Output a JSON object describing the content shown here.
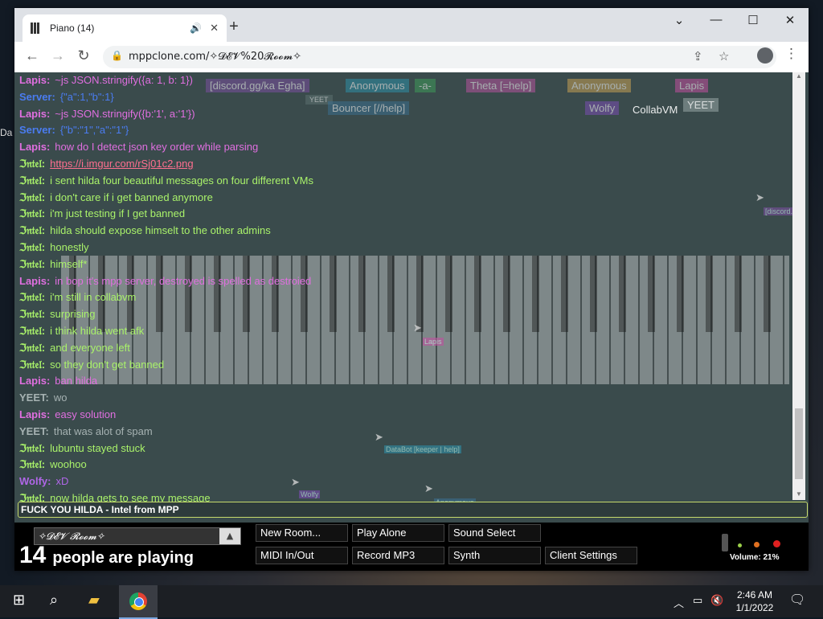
{
  "desktop": {
    "edge_labels": [
      "Da"
    ]
  },
  "browser": {
    "tab_title": "Piano (14)",
    "tab_close": "✕",
    "new_tab": "+",
    "url": "mppclone.com/✧𝓓𝓔𝓥%20𝓡𝓸𝓸𝓶✧",
    "window_controls": {
      "dropdown": "⌄",
      "minimize": "—",
      "maximize": "☐",
      "close": "✕"
    }
  },
  "page": {
    "ghost_tags": [
      {
        "text": "[discord.gg/ka Egha]",
        "bg": "#7a4f9e"
      },
      {
        "text": "Anonymous",
        "bg": "#2f8fa6"
      },
      {
        "text": "-a-",
        "bg": "#3f9a5a"
      },
      {
        "text": "Theta [=help]",
        "bg": "#b5539c"
      },
      {
        "text": "Anonymous",
        "bg": "#c5a055"
      },
      {
        "text": "Lapis",
        "bg": "#c24f9f"
      },
      {
        "text": "YEET",
        "bg": "#5b7070"
      },
      {
        "text": "Bouncer [//help]",
        "bg": "#3b6f8f"
      },
      {
        "text": "Wolfy",
        "bg": "#7b4db2"
      },
      {
        "text": "CollabVM",
        "bg": "#3a4b4c"
      },
      {
        "text": "YEET",
        "bg": "#7a8a8a"
      }
    ],
    "cursor_tags": [
      "Lapis",
      "Anonymous",
      "DataBot [keeper | help]",
      "Wolfy",
      "Anonymous",
      "[discord...]"
    ],
    "chat": [
      {
        "name": "Lapis:",
        "msg": "~js JSON.stringify({a: 1, b: 1})",
        "color": "#e06fe0"
      },
      {
        "name": "Server:",
        "msg": "{\"a\":1,\"b\":1}",
        "color": "#4a7cf0"
      },
      {
        "name": "Lapis:",
        "msg": "~js JSON.stringify({b:'1', a:'1'})",
        "color": "#e06fe0"
      },
      {
        "name": "Server:",
        "msg": "{\"b\":\"1\",\"a\":\"1\"}",
        "color": "#4a7cf0"
      },
      {
        "name": "Lapis:",
        "msg": "how do I detect json key order while parsing",
        "color": "#e06fe0"
      },
      {
        "name": "ℑ𝔫𝔱𝔢𝔩:",
        "msg": "https://i.imgur.com/rSj01c2.png",
        "color": "#a9f26a",
        "link": true
      },
      {
        "name": "ℑ𝔫𝔱𝔢𝔩:",
        "msg": "i sent hilda four beautiful messages on four different VMs",
        "color": "#a9f26a"
      },
      {
        "name": "ℑ𝔫𝔱𝔢𝔩:",
        "msg": "i don't care if i get banned anymore",
        "color": "#a9f26a"
      },
      {
        "name": "ℑ𝔫𝔱𝔢𝔩:",
        "msg": "i'm just testing if I get banned",
        "color": "#a9f26a"
      },
      {
        "name": "ℑ𝔫𝔱𝔢𝔩:",
        "msg": "hilda should expose himselt to the other admins",
        "color": "#a9f26a"
      },
      {
        "name": "ℑ𝔫𝔱𝔢𝔩:",
        "msg": "honestly",
        "color": "#a9f26a"
      },
      {
        "name": "ℑ𝔫𝔱𝔢𝔩:",
        "msg": "himself*",
        "color": "#a9f26a"
      },
      {
        "name": "Lapis:",
        "msg": "in bop it's mpp server, destroyed is spelled as destroied",
        "color": "#e06fe0"
      },
      {
        "name": "ℑ𝔫𝔱𝔢𝔩:",
        "msg": "i'm still in collabvm",
        "color": "#a9f26a"
      },
      {
        "name": "ℑ𝔫𝔱𝔢𝔩:",
        "msg": "surprising",
        "color": "#a9f26a"
      },
      {
        "name": "ℑ𝔫𝔱𝔢𝔩:",
        "msg": "i think hilda went afk",
        "color": "#a9f26a"
      },
      {
        "name": "ℑ𝔫𝔱𝔢𝔩:",
        "msg": "and everyone left",
        "color": "#a9f26a"
      },
      {
        "name": "ℑ𝔫𝔱𝔢𝔩:",
        "msg": "so they don't get banned",
        "color": "#a9f26a"
      },
      {
        "name": "Lapis:",
        "msg": "ban hilda",
        "color": "#e06fe0"
      },
      {
        "name": "YEET:",
        "msg": "wo",
        "color": "#a6b2b2"
      },
      {
        "name": "Lapis:",
        "msg": "easy solution",
        "color": "#e06fe0"
      },
      {
        "name": "YEET:",
        "msg": "that was alot of spam",
        "color": "#a6b2b2"
      },
      {
        "name": "ℑ𝔫𝔱𝔢𝔩:",
        "msg": "lubuntu stayed stuck",
        "color": "#a9f26a"
      },
      {
        "name": "ℑ𝔫𝔱𝔢𝔩:",
        "msg": "woohoo",
        "color": "#a9f26a"
      },
      {
        "name": "Wolfy:",
        "msg": "xD",
        "color": "#b066e8"
      },
      {
        "name": "ℑ𝔫𝔱𝔢𝔩:",
        "msg": "now hilda gets to see my message",
        "color": "#a9f26a"
      }
    ],
    "chat_input": "FUCK YOU HILDA - Intel from MPP"
  },
  "bottom": {
    "room": "✧𝓓𝓔𝓥 𝓡𝓸𝓸𝓶✧",
    "room_arrow": "▲",
    "count": "14",
    "count_text": "people are playing",
    "buttons": [
      "New Room...",
      "Play Alone",
      "Sound Select",
      "MIDI In/Out",
      "Record MP3",
      "Synth",
      "Client Settings"
    ],
    "volume": "Volume: 21%"
  },
  "taskbar": {
    "time": "2:46 AM",
    "date": "1/1/2022"
  }
}
